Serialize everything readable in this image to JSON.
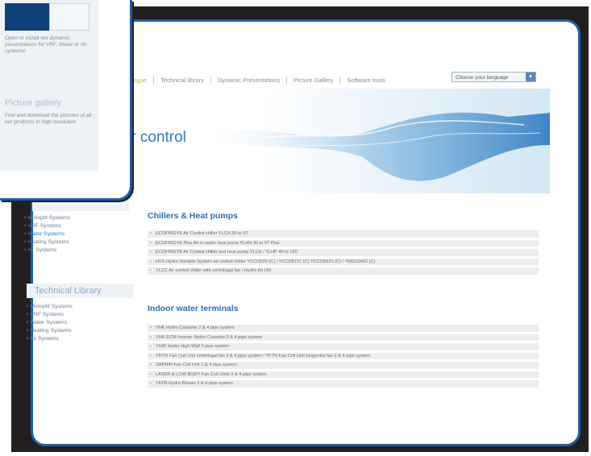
{
  "nav": {
    "items": [
      "Catalogue",
      "Technical library",
      "Dynamic Presentations",
      "Picture Gallery",
      "Software tools"
    ],
    "active_index": 0,
    "language_label": "Choose your language"
  },
  "hero": {
    "tagline": "under control"
  },
  "sidebar": {
    "systems": [
      "Minisplit Systems",
      "VRF Systems",
      "Water Systems",
      "Heating Systems",
      "Air Systems"
    ],
    "selected": "Water Systems",
    "tech_library_title": "Technical Library",
    "tech_library_items": [
      "Minisplit Systems",
      "VRF Systems",
      "Water Systems",
      "Heating Systems",
      "Air Systems"
    ]
  },
  "sections": [
    {
      "title": "Chillers & Heat pumps",
      "rows": [
        "ECOFRIGYE Air Cooled chiller YLCH 30 to 97",
        "ECOFRIGYE Plus Air to water heat pump YLHN 30 to 97 Plus",
        "ECOFRIGYE Air Cooled chiller and heat pump YLCH / YLHP 40 to 180",
        "HVS Hydro Variable System air cooled chiller YCCO520 (C) / YCCO5721 (C) YCCO5621 (C) / YMSC0452 (C)",
        "YLCC Air cooled chiller with centrifugal fan / Hydro Kit ON"
      ]
    },
    {
      "title": "Indoor water terminals",
      "rows": [
        "YHK Hydro Cassette 2 & 4 pipe system",
        "YHK ECM Inverter Hydro Cassette 2 & 4 pipe system",
        "YHW Hydro High Wall 2 pipe system",
        "YFCN Fan Coil Unit centrifugal fan 2 & 4 pipe system / YFTN Fan Coil Unit tangential fan 2 & 4 pipe system",
        "SAPHIR Fan Coil Unit 2 & 4 pipe system",
        "LASER & LOW BODY Fan Coil Units 2 & 4 pipe system",
        "YEFB Hydro Blower 2 & 4 pipe system"
      ]
    }
  ],
  "overlay": {
    "text1": "Open or install our dynamic presentations for VRF, Water or Air systems!",
    "title": "Picture gallery",
    "text2": "Find and download the pictures of all our products in high resolution"
  }
}
